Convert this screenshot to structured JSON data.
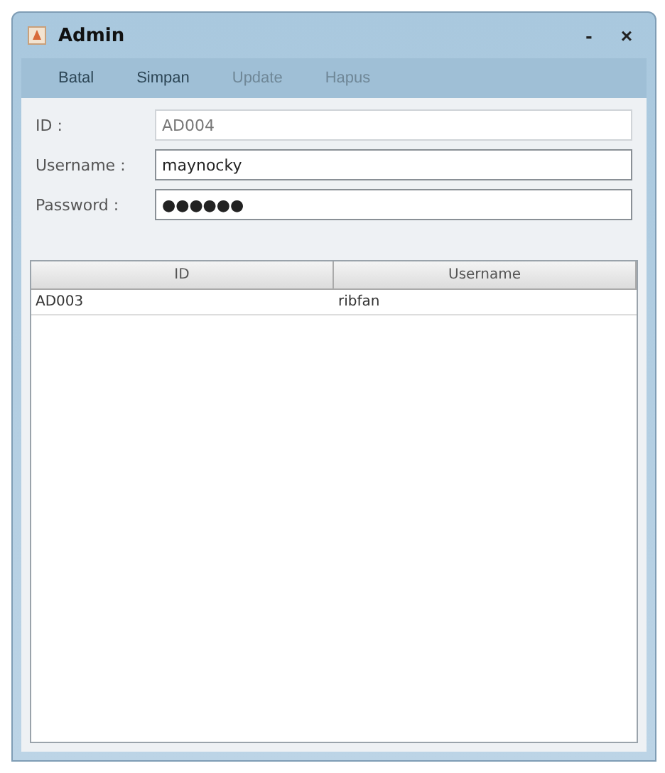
{
  "window": {
    "title": "Admin",
    "controls": [
      "-",
      "×"
    ]
  },
  "toolbar": [
    {
      "label": "Batal",
      "disabled": false
    },
    {
      "label": "Simpan",
      "disabled": false
    },
    {
      "label": "Update",
      "disabled": true
    },
    {
      "label": "Hapus",
      "disabled": true
    }
  ],
  "form": [
    {
      "label": "ID :",
      "value": "AD004",
      "disabled": true
    },
    {
      "label": "Username :",
      "value": "maynocky",
      "disabled": false
    },
    {
      "label": "Password :",
      "value": "●●●●●●",
      "disabled": false
    }
  ],
  "table": {
    "columns": [
      "ID",
      "Username"
    ],
    "rows": [
      [
        "AD003",
        "ribfan"
      ]
    ]
  }
}
